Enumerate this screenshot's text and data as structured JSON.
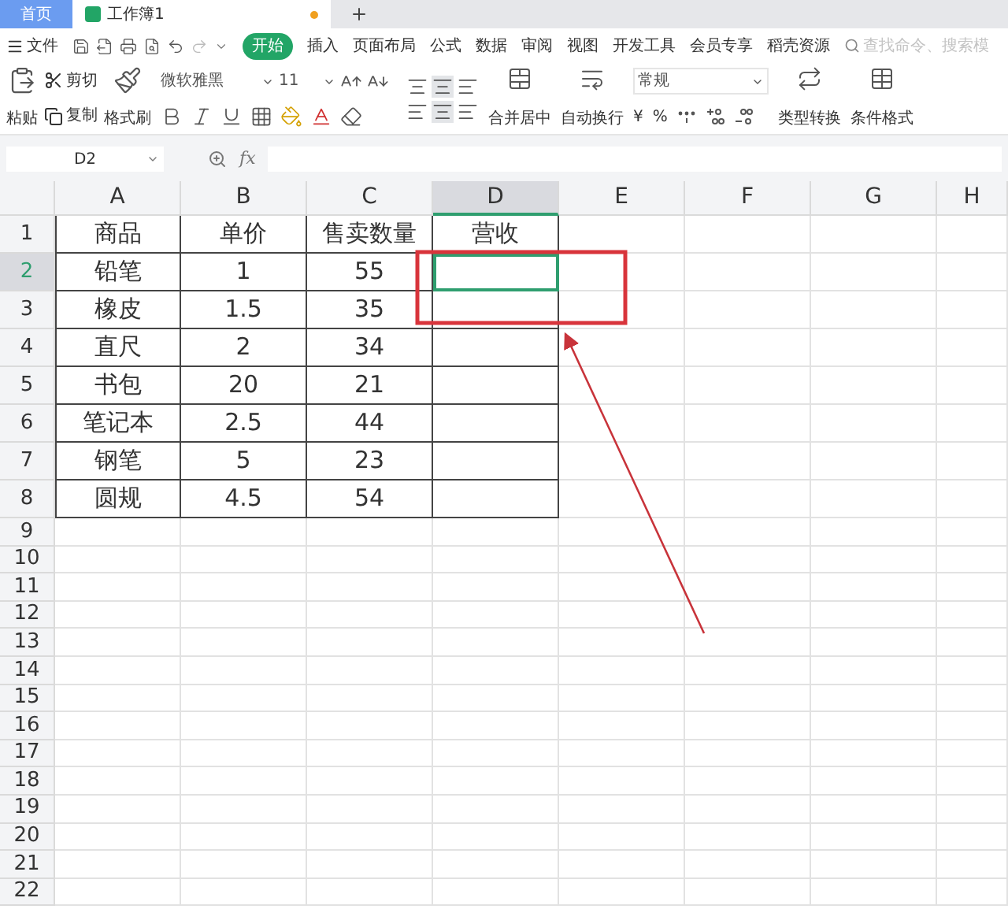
{
  "tabs": [
    {
      "label": "首页",
      "selected": false,
      "unsaved": false
    },
    {
      "label": "工作簿1",
      "selected": true,
      "unsaved": true
    }
  ],
  "menu": {
    "file": "文件",
    "items": [
      {
        "label": "开始",
        "selected": true
      },
      {
        "label": "插入",
        "selected": false
      },
      {
        "label": "页面布局",
        "selected": false
      },
      {
        "label": "公式",
        "selected": false
      },
      {
        "label": "数据",
        "selected": false
      },
      {
        "label": "审阅",
        "selected": false
      },
      {
        "label": "视图",
        "selected": false
      },
      {
        "label": "开发工具",
        "selected": false
      },
      {
        "label": "会员专享",
        "selected": false
      },
      {
        "label": "稻壳资源",
        "selected": false
      }
    ],
    "search": {
      "placeholder": "查找命令、搜索模"
    }
  },
  "ribbon": {
    "paste": "粘贴",
    "cut": "剪切",
    "copy": "复制",
    "format_painter": "格式刷",
    "font_name": "微软雅黑",
    "font_size": "11",
    "merge": "合并居中",
    "wrap": "自动换行",
    "number_format": "常规",
    "currency": "¥",
    "percent": "%",
    "convert": "类型转换",
    "conditional": "条件格式"
  },
  "formula_bar": {
    "cell_ref": "D2",
    "fx": "fx"
  },
  "sheet": {
    "columns": [
      {
        "label": "A",
        "selected": false
      },
      {
        "label": "B",
        "selected": false
      },
      {
        "label": "C",
        "selected": false
      },
      {
        "label": "D",
        "selected": true
      },
      {
        "label": "E",
        "selected": false
      },
      {
        "label": "F",
        "selected": false
      },
      {
        "label": "G",
        "selected": false
      },
      {
        "label": "H",
        "selected": false
      }
    ],
    "rows": [
      {
        "number": "1",
        "selected": false,
        "cells": [
          "商品",
          "单价",
          "售卖数量",
          "营收"
        ]
      },
      {
        "number": "2",
        "selected": true,
        "cells": [
          "铅笔",
          "1",
          "55",
          ""
        ]
      },
      {
        "number": "3",
        "selected": false,
        "cells": [
          "橡皮",
          "1.5",
          "35",
          ""
        ]
      },
      {
        "number": "4",
        "selected": false,
        "cells": [
          "直尺",
          "2",
          "34",
          ""
        ]
      },
      {
        "number": "5",
        "selected": false,
        "cells": [
          "书包",
          "20",
          "21",
          ""
        ]
      },
      {
        "number": "6",
        "selected": false,
        "cells": [
          "笔记本",
          "2.5",
          "44",
          ""
        ]
      },
      {
        "number": "7",
        "selected": false,
        "cells": [
          "钢笔",
          "5",
          "23",
          ""
        ]
      },
      {
        "number": "8",
        "selected": false,
        "cells": [
          "圆规",
          "4.5",
          "54",
          ""
        ]
      },
      {
        "number": "9",
        "selected": false
      },
      {
        "number": "10",
        "selected": false
      },
      {
        "number": "11",
        "selected": false
      },
      {
        "number": "12",
        "selected": false
      },
      {
        "number": "13",
        "selected": false
      },
      {
        "number": "14",
        "selected": false
      },
      {
        "number": "15",
        "selected": false
      },
      {
        "number": "16",
        "selected": false
      },
      {
        "number": "17",
        "selected": false
      },
      {
        "number": "18",
        "selected": false
      },
      {
        "number": "19",
        "selected": false
      },
      {
        "number": "20",
        "selected": false
      },
      {
        "number": "21",
        "selected": false
      },
      {
        "number": "22",
        "selected": false
      }
    ]
  }
}
